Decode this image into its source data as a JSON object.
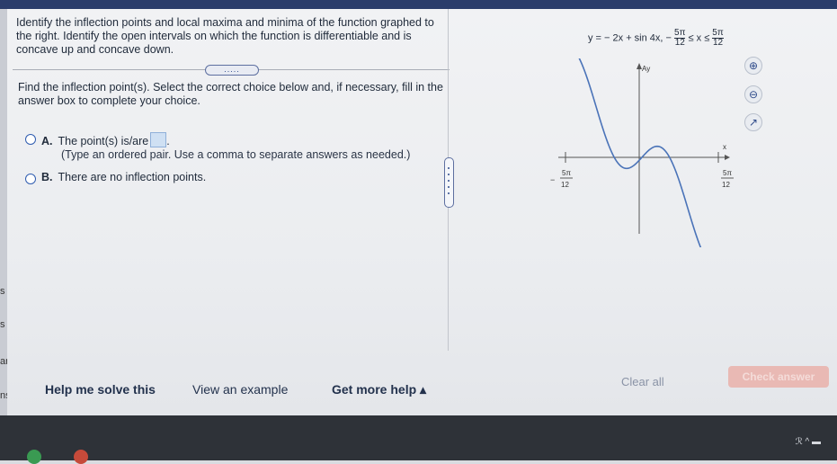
{
  "question": {
    "text": "Identify the inflection points and local maxima and minima of the function graphed to the right. Identify the open intervals on which the function is differentiable and is concave up and concave down."
  },
  "more_button": {
    "label": "....."
  },
  "prompt": {
    "text": "Find the inflection point(s). Select the correct choice below and, if necessary, fill in the answer box to complete your choice."
  },
  "choices": [
    {
      "letter": "A.",
      "text": "The point(s) is/are",
      "note": "(Type an ordered pair. Use a comma to separate answers as needed.)"
    },
    {
      "letter": "B.",
      "text": "There are no inflection points."
    }
  ],
  "graph": {
    "formula_left": "y = − 2x + sin 4x, −",
    "frac_num": "5π",
    "frac_den": "12",
    "leq_x_leq": "≤ x ≤",
    "x_axis_label": "x",
    "y_axis_label": "Ay",
    "tick_left_num": "5π",
    "tick_left_den": "12",
    "tick_left_sign": "−",
    "tick_right_num": "5π",
    "tick_right_den": "12"
  },
  "tools": [
    {
      "icon": "zoom-in-icon",
      "glyph": "⊕"
    },
    {
      "icon": "zoom-out-icon",
      "glyph": "⊖"
    },
    {
      "icon": "external-link-icon",
      "glyph": "↗"
    }
  ],
  "left_strip": {
    "s1": "s",
    "s2": "s",
    "ary": "ary",
    "ns": "ns"
  },
  "footer": {
    "help_solve": "Help me solve this",
    "view_example": "View an example",
    "get_more_help": "Get more help ▴",
    "clear_all": "Clear all",
    "check_answer": "Check answer"
  },
  "taskbar": {
    "tray_text": "ℛ ^ ▬"
  },
  "colors": {
    "curve": "#4a73b8",
    "accent": "#2f5cb0",
    "check_button": "#e9b9b4"
  }
}
